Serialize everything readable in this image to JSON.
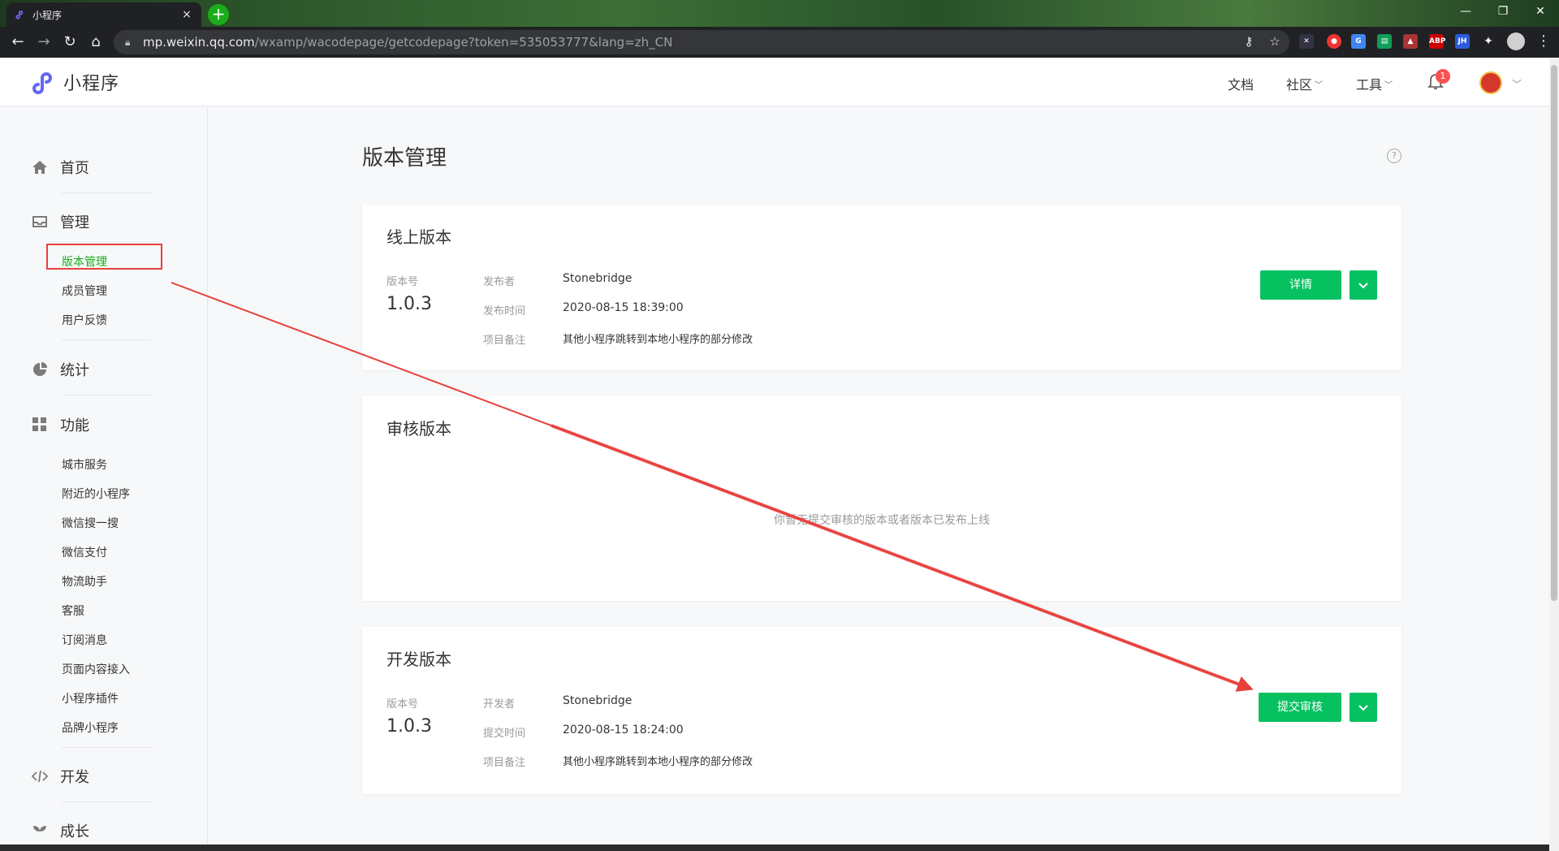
{
  "browser": {
    "tab_title": "小程序",
    "tab_close": "×",
    "new_tab": "+",
    "url_host": "mp.weixin.qq.com",
    "url_path": "/wxamp/wacodepage/getcodepage?token=535053777&lang=zh_CN",
    "ext_abp": "ABP",
    "ext_jh": "JH"
  },
  "header": {
    "logo_text": "小程序",
    "nav": {
      "docs": "文档",
      "community": "社区",
      "tools": "工具"
    },
    "notification_count": "1"
  },
  "sidebar": {
    "home": "首页",
    "manage": "管理",
    "manage_items": [
      "版本管理",
      "成员管理",
      "用户反馈"
    ],
    "stats": "统计",
    "features": "功能",
    "feature_items": [
      "城市服务",
      "附近的小程序",
      "微信搜一搜",
      "微信支付",
      "物流助手",
      "客服",
      "订阅消息",
      "页面内容接入",
      "小程序插件",
      "品牌小程序"
    ],
    "dev": "开发",
    "growth": "成长"
  },
  "main": {
    "title": "版本管理",
    "help": "?",
    "online": {
      "title": "线上版本",
      "version_label": "版本号",
      "version": "1.0.3",
      "publisher_key": "发布者",
      "publisher": "Stonebridge",
      "time_key": "发布时间",
      "time": "2020-08-15 18:39:00",
      "note_key": "项目备注",
      "note": "其他小程序跳转到本地小程序的部分修改",
      "detail_button": "详情"
    },
    "review": {
      "title": "审核版本",
      "empty": "你暂无提交审核的版本或者版本已发布上线"
    },
    "dev": {
      "title": "开发版本",
      "version_label": "版本号",
      "version": "1.0.3",
      "developer_key": "开发者",
      "developer": "Stonebridge",
      "time_key": "提交时间",
      "time": "2020-08-15 18:24:00",
      "note_key": "项目备注",
      "note": "其他小程序跳转到本地小程序的部分修改",
      "submit_button": "提交审核"
    }
  },
  "colors": {
    "brand_green": "#07c160",
    "active_green": "#1aad19",
    "annotation_red": "#e8403c"
  }
}
